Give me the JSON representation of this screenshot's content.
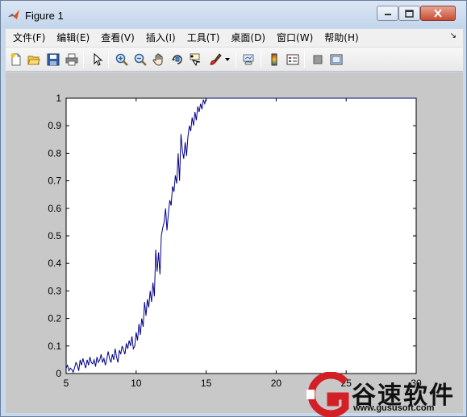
{
  "window": {
    "title": "Figure 1"
  },
  "menu": {
    "items": [
      {
        "label": "文件(F)"
      },
      {
        "label": "编辑(E)"
      },
      {
        "label": "查看(V)"
      },
      {
        "label": "插入(I)"
      },
      {
        "label": "工具(T)"
      },
      {
        "label": "桌面(D)"
      },
      {
        "label": "窗口(W)"
      },
      {
        "label": "帮助(H)"
      }
    ]
  },
  "toolbar": {
    "buttons": [
      {
        "icon": "new-figure-icon"
      },
      {
        "icon": "open-file-icon"
      },
      {
        "icon": "save-icon"
      },
      {
        "icon": "print-icon"
      },
      {
        "icon": "edit-plot-arrow-icon"
      },
      {
        "icon": "zoom-in-icon"
      },
      {
        "icon": "zoom-out-icon"
      },
      {
        "icon": "pan-hand-icon"
      },
      {
        "icon": "rotate-3d-icon"
      },
      {
        "icon": "data-cursor-icon"
      },
      {
        "icon": "brush-icon"
      },
      {
        "icon": "link-plot-icon"
      },
      {
        "icon": "colorbar-icon"
      },
      {
        "icon": "legend-icon"
      },
      {
        "icon": "hide-plot-tools-icon"
      },
      {
        "icon": "show-plot-tools-icon"
      }
    ]
  },
  "watermark": {
    "brand": "谷速软件",
    "url": "www.gususoft.com"
  },
  "chart_data": {
    "type": "line",
    "title": "",
    "xlabel": "",
    "ylabel": "",
    "xlim": [
      5,
      30
    ],
    "ylim": [
      0,
      1
    ],
    "xticks": [
      5,
      10,
      15,
      20,
      25,
      30
    ],
    "xtick_labels": [
      "5",
      "10",
      "15",
      "20",
      "25",
      "30"
    ],
    "yticks": [
      0,
      0.1,
      0.2,
      0.3,
      0.4,
      0.5,
      0.6,
      0.7,
      0.8,
      0.9,
      1
    ],
    "ytick_labels": [
      "0",
      "0.1",
      "0.2",
      "0.3",
      "0.4",
      "0.5",
      "0.6",
      "0.7",
      "0.8",
      "0.9",
      "1"
    ],
    "grid": false,
    "line_color": "#00008b",
    "x": [
      5.0,
      5.1,
      5.2,
      5.3,
      5.4,
      5.5,
      5.6,
      5.7,
      5.8,
      5.9,
      6.0,
      6.1,
      6.2,
      6.3,
      6.4,
      6.5,
      6.6,
      6.7,
      6.8,
      6.9,
      7.0,
      7.1,
      7.2,
      7.3,
      7.4,
      7.5,
      7.6,
      7.7,
      7.8,
      7.9,
      8.0,
      8.1,
      8.2,
      8.3,
      8.4,
      8.5,
      8.6,
      8.7,
      8.8,
      8.9,
      9.0,
      9.1,
      9.2,
      9.3,
      9.4,
      9.5,
      9.6,
      9.7,
      9.8,
      9.9,
      10.0,
      10.1,
      10.2,
      10.3,
      10.4,
      10.5,
      10.6,
      10.7,
      10.8,
      10.9,
      11.0,
      11.1,
      11.2,
      11.3,
      11.4,
      11.5,
      11.6,
      11.7,
      11.8,
      11.9,
      12.0,
      12.1,
      12.2,
      12.3,
      12.4,
      12.5,
      12.6,
      12.7,
      12.8,
      12.9,
      13.0,
      13.1,
      13.2,
      13.3,
      13.4,
      13.5,
      13.6,
      13.7,
      13.8,
      13.9,
      14.0,
      14.1,
      14.2,
      14.3,
      14.4,
      14.5,
      14.6,
      14.7,
      14.8,
      14.9,
      15.0,
      15.1,
      15.2,
      15.3,
      15.4,
      15.5,
      16.0,
      20.0,
      25.0,
      30.0
    ],
    "y": [
      0.02,
      0.03,
      0.01,
      0.02,
      0.015,
      0.005,
      0.02,
      0.04,
      0.03,
      0.01,
      0.05,
      0.03,
      0.055,
      0.035,
      0.02,
      0.05,
      0.03,
      0.06,
      0.04,
      0.035,
      0.05,
      0.025,
      0.06,
      0.04,
      0.05,
      0.07,
      0.04,
      0.055,
      0.03,
      0.05,
      0.08,
      0.055,
      0.04,
      0.07,
      0.05,
      0.09,
      0.06,
      0.04,
      0.085,
      0.07,
      0.1,
      0.085,
      0.07,
      0.11,
      0.09,
      0.12,
      0.1,
      0.135,
      0.09,
      0.1,
      0.15,
      0.12,
      0.18,
      0.14,
      0.2,
      0.17,
      0.26,
      0.21,
      0.27,
      0.24,
      0.3,
      0.26,
      0.33,
      0.28,
      0.45,
      0.37,
      0.44,
      0.36,
      0.5,
      0.53,
      0.55,
      0.6,
      0.52,
      0.58,
      0.63,
      0.61,
      0.68,
      0.66,
      0.72,
      0.69,
      0.8,
      0.7,
      0.87,
      0.81,
      0.78,
      0.84,
      0.79,
      0.86,
      0.9,
      0.88,
      0.93,
      0.9,
      0.95,
      0.92,
      0.97,
      0.95,
      0.98,
      0.96,
      0.995,
      0.98,
      1.0,
      1.0,
      1.0,
      1.0,
      1.0,
      1.0,
      1.0,
      1.0,
      1.0,
      1.0
    ]
  }
}
